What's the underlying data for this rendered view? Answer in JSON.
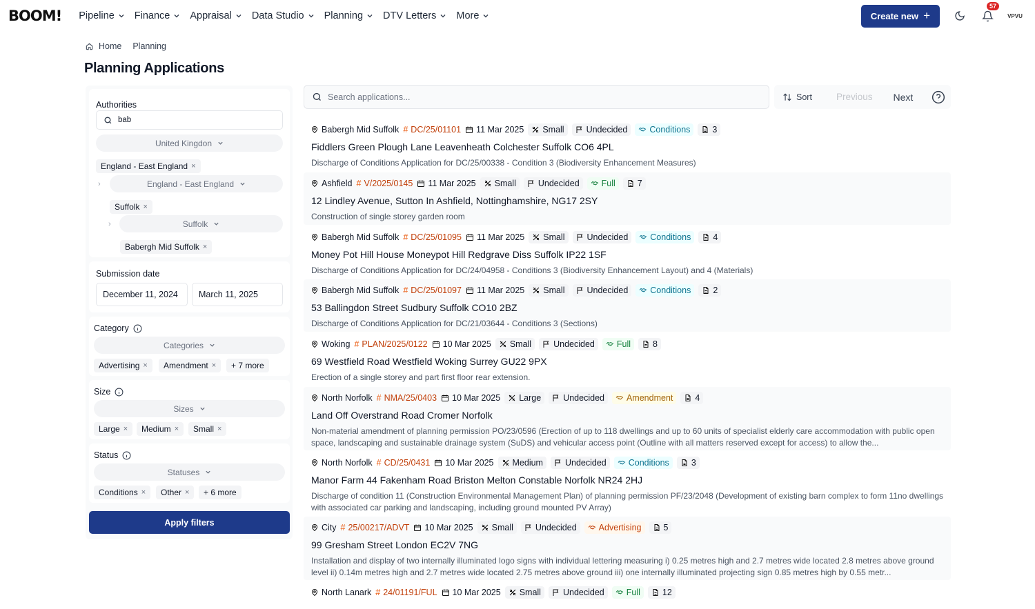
{
  "app": {
    "logo": "BOOM!"
  },
  "nav": [
    {
      "label": "Pipeline"
    },
    {
      "label": "Finance"
    },
    {
      "label": "Appraisal"
    },
    {
      "label": "Data Studio"
    },
    {
      "label": "Planning"
    },
    {
      "label": "DTV Letters"
    },
    {
      "label": "More"
    }
  ],
  "header": {
    "create_label": "Create new",
    "notification_count": "57",
    "avatar_text": "VPVU"
  },
  "breadcrumb": {
    "home": "Home",
    "current": "Planning"
  },
  "page": {
    "title": "Planning Applications"
  },
  "filters": {
    "authorities": {
      "label": "Authorities",
      "search_value": "bab",
      "country_select": "United Kingdon",
      "country_chip": "England - East England",
      "region_select": "England - East England",
      "region_chip": "Suffolk",
      "county_select": "Suffolk",
      "county_chip": "Babergh Mid Suffolk"
    },
    "submission_date": {
      "label": "Submission date",
      "from": "December 11, 2024",
      "to": "March 11, 2025"
    },
    "category": {
      "label": "Category",
      "placeholder": "Categories",
      "chips": [
        "Advertising",
        "Amendment"
      ],
      "more": "+ 7 more"
    },
    "size": {
      "label": "Size",
      "placeholder": "Sizes",
      "chips": [
        "Large",
        "Medium",
        "Small"
      ]
    },
    "status": {
      "label": "Status",
      "placeholder": "Statuses",
      "chips": [
        "Conditions",
        "Other"
      ],
      "more": "+ 6 more"
    },
    "apply_label": "Apply filters"
  },
  "search": {
    "placeholder": "Search applications..."
  },
  "toolbar": {
    "sort_label": "Sort",
    "previous_label": "Previous",
    "next_label": "Next"
  },
  "applications": [
    {
      "authority": "Babergh Mid Suffolk",
      "ref": "DC/25/01101",
      "date": "11 Mar 2025",
      "size": "Small",
      "decision": "Undecided",
      "type": "Conditions",
      "type_style": "cond",
      "docs": "3",
      "address": "Fiddlers Green Plough Lane Leavenheath Colchester Suffolk CO6 4PL",
      "description": "Discharge of Conditions Application for DC/25/00338 - Condition 3 (Biodiversity Enhancement Measures)"
    },
    {
      "authority": "Ashfield",
      "ref": "V/2025/0145",
      "date": "11 Mar 2025",
      "size": "Small",
      "decision": "Undecided",
      "type": "Full",
      "type_style": "full",
      "docs": "7",
      "address": "12 Lindley Avenue, Sutton In Ashfield, Nottinghamshire, NG17 2SY",
      "description": "Construction of single storey garden room"
    },
    {
      "authority": "Babergh Mid Suffolk",
      "ref": "DC/25/01095",
      "date": "11 Mar 2025",
      "size": "Small",
      "decision": "Undecided",
      "type": "Conditions",
      "type_style": "cond",
      "docs": "4",
      "address": "Money Pot Hill House Moneypot Hill Redgrave Diss Suffolk IP22 1SF",
      "description": "Discharge of Conditions Application for DC/24/04958 - Conditions 3 (Biodiversity Enhancement Layout) and 4 (Materials)"
    },
    {
      "authority": "Babergh Mid Suffolk",
      "ref": "DC/25/01097",
      "date": "11 Mar 2025",
      "size": "Small",
      "decision": "Undecided",
      "type": "Conditions",
      "type_style": "cond",
      "docs": "2",
      "address": "53 Ballingdon Street Sudbury Suffolk CO10 2BZ",
      "description": "Discharge of Conditions Application for DC/21/03644 - Conditions 3 (Sections)"
    },
    {
      "authority": "Woking",
      "ref": "PLAN/2025/0122",
      "date": "10 Mar 2025",
      "size": "Small",
      "decision": "Undecided",
      "type": "Full",
      "type_style": "full",
      "docs": "8",
      "address": "69 Westfield Road Westfield Woking Surrey GU22 9PX",
      "description": "Erection of a single storey and part first floor rear extension."
    },
    {
      "authority": "North Norfolk",
      "ref": "NMA/25/0403",
      "date": "10 Mar 2025",
      "size": "Large",
      "decision": "Undecided",
      "type": "Amendment",
      "type_style": "amend",
      "docs": "4",
      "address": "Land Off Overstrand Road Cromer Norfolk",
      "description": "Non-material amendment of planning permission PO/23/0596 (Erection of up to 118 dwellings and up to 60 units of specialist elderly care accommodation with public open space, landscaping and sustainable drainage system (SuDS) and vehicular access point (Outline with all matters reserved except for access) to allow the..."
    },
    {
      "authority": "North Norfolk",
      "ref": "CD/25/0431",
      "date": "10 Mar 2025",
      "size": "Medium",
      "decision": "Undecided",
      "type": "Conditions",
      "type_style": "cond",
      "docs": "3",
      "address": "Manor Farm 44 Fakenham Road Briston Melton Constable Norfolk NR24 2HJ",
      "description": "Discharge of condition 11 (Construction Environmental Management Plan) of planning permission PF/23/2048 (Development of existing barn complex to form 11no dwellings with associated car parking and landscaping, including ground mounted PV Array)"
    },
    {
      "authority": "City",
      "ref": "25/00217/ADVT",
      "date": "10 Mar 2025",
      "size": "Small",
      "decision": "Undecided",
      "type": "Advertising",
      "type_style": "adv",
      "docs": "5",
      "address": "99 Gresham Street London EC2V 7NG",
      "description": "Installation and display of two internally illuminated logo signs with individual lettering measuring i) 0.25 metres high and 2.7 metres wide located 2.8 metres above ground level ii) 0.14m metres high and 2.7 metres wide located 2.75 metres above ground iii) one internally illuminated projecting sign 0.85 metres high by 0.55 metr..."
    },
    {
      "authority": "North Lanark",
      "ref": "24/01191/FUL",
      "date": "10 Mar 2025",
      "size": "Small",
      "decision": "Undecided",
      "type": "Full",
      "type_style": "full",
      "docs": "12",
      "address": "",
      "description": ""
    }
  ]
}
